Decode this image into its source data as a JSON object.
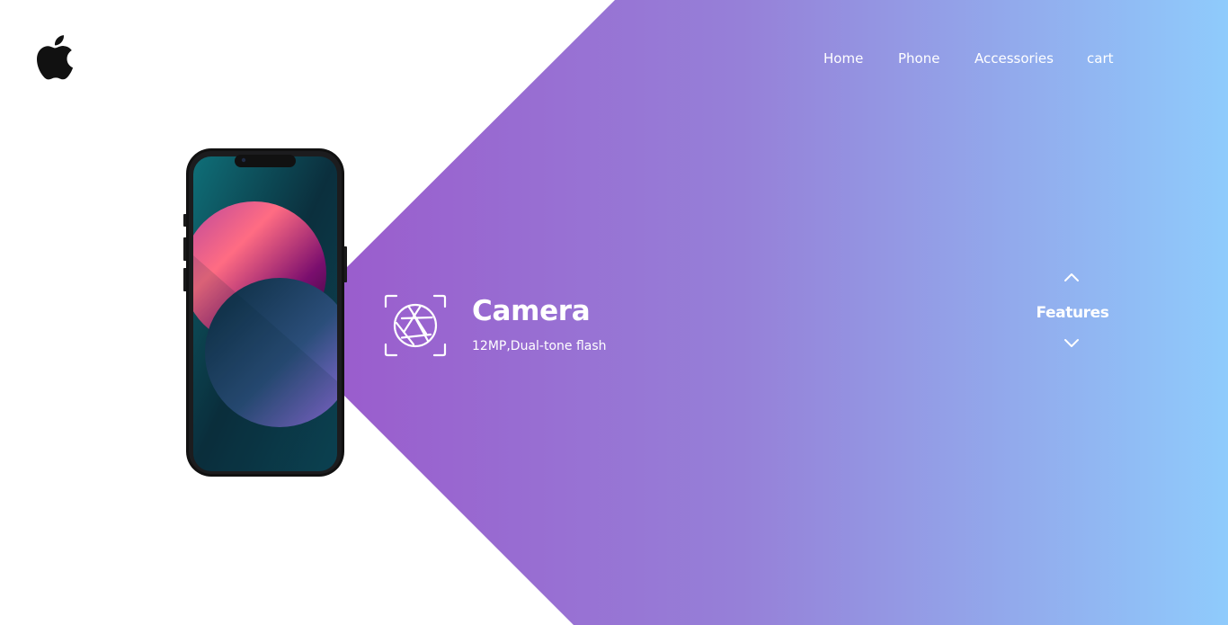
{
  "brand": {
    "logo_icon": "apple-logo-icon"
  },
  "nav": {
    "home": "Home",
    "phone": "Phone",
    "accessories": "Accessories",
    "cart": "cart"
  },
  "hero": {
    "product_image": "smartphone-image",
    "feature": {
      "icon": "camera-aperture-icon",
      "title": "Camera",
      "description": "12MP,Dual-tone flash"
    }
  },
  "features_nav": {
    "label": "Features",
    "up_icon": "chevron-up-icon",
    "down_icon": "chevron-down-icon"
  },
  "colors": {
    "gradient_start": "#9a5fcf",
    "gradient_end": "#8fcbfc",
    "text_light": "#ffffff",
    "logo": "#111111"
  }
}
